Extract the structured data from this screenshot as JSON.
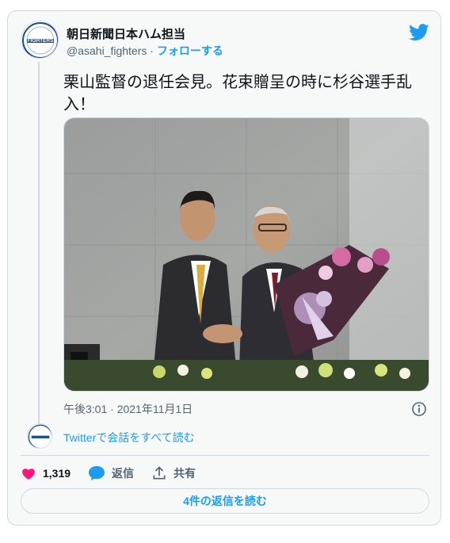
{
  "colors": {
    "accent": "#1d9bf0",
    "like": "#f91880",
    "text": "#0f1419",
    "muted": "#536471",
    "border": "#cfd9de",
    "logo_blue": "#1f4e8c"
  },
  "account": {
    "display_name": "朝日新聞日本ハム担当",
    "handle": "@asahi_fighters",
    "separator": "·",
    "follow_label": "フォローする",
    "avatar_logo_text": "FIGHTERS"
  },
  "tweet": {
    "text": "栗山監督の退任会見。花束贈呈の時に杉谷選手乱入！",
    "timestamp": "午後3:01 · 2021年11月1日"
  },
  "icons": {
    "brand": "twitter-bird-icon",
    "info": "info-icon",
    "like": "heart-icon",
    "reply": "speech-bubble-icon",
    "share": "share-icon"
  },
  "conversation": {
    "read_label": "Twitterで会話をすべて読む"
  },
  "actions": {
    "like_count": "1,319",
    "reply_label": "返信",
    "share_label": "共有"
  },
  "read_replies_label": "4件の返信を読む"
}
